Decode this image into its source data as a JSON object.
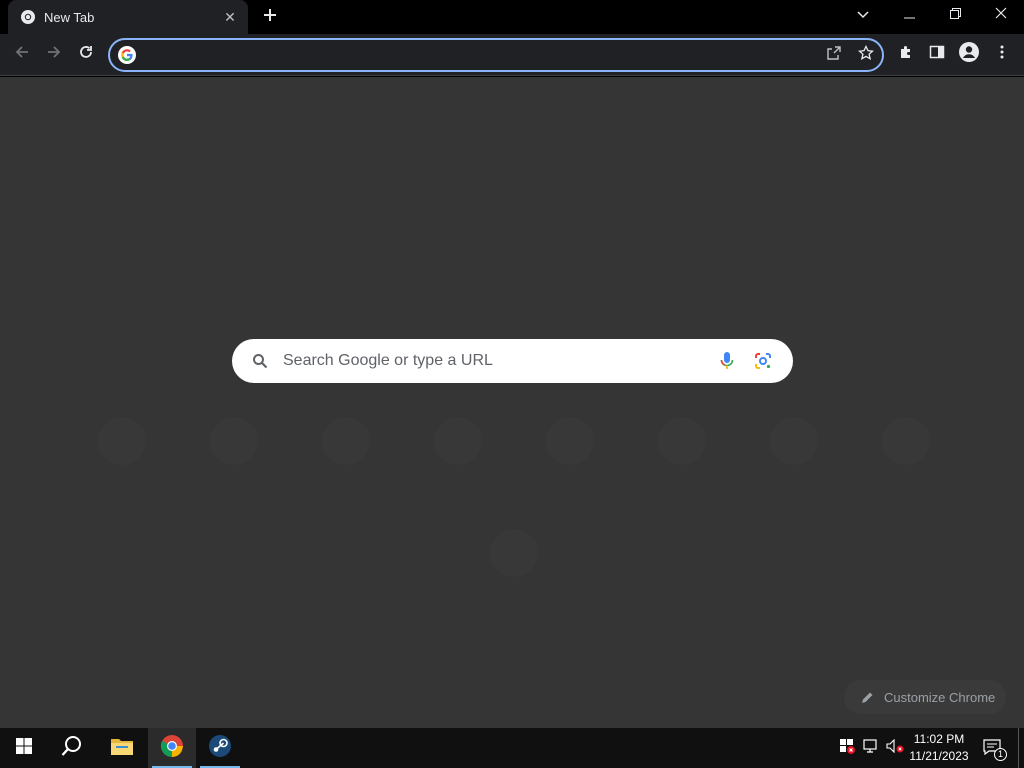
{
  "browser": {
    "tab": {
      "title": "New Tab",
      "favicon": "chrome-icon"
    },
    "new_tab_icon": "plus-icon",
    "window_controls": [
      "tab-search-icon",
      "minimize-icon",
      "restore-icon",
      "close-icon"
    ],
    "toolbar": {
      "back_icon": "back-arrow-icon",
      "forward_icon": "forward-arrow-icon",
      "reload_icon": "reload-icon",
      "omnibox": {
        "value": "",
        "placeholder": ""
      },
      "right_icons": [
        "share-icon",
        "bookmark-star-icon"
      ],
      "extensions": [
        "puzzle-icon",
        "side-panel-icon",
        "profile-icon",
        "menu-kebab-icon"
      ]
    },
    "accent": "#8ab4f8"
  },
  "ntp": {
    "search_placeholder": "Search Google or type a URL",
    "customize_label": "Customize Chrome",
    "background": "#353535"
  },
  "taskbar": {
    "apps": [
      "windows-start-icon",
      "search-icon",
      "file-explorer-icon",
      "chrome-icon",
      "steam-icon"
    ],
    "tray_icons": [
      "security-alert-icon",
      "network-icon",
      "volume-muted-icon"
    ],
    "time": "11:02 PM",
    "date": "11/21/2023",
    "notification_count": "1"
  }
}
